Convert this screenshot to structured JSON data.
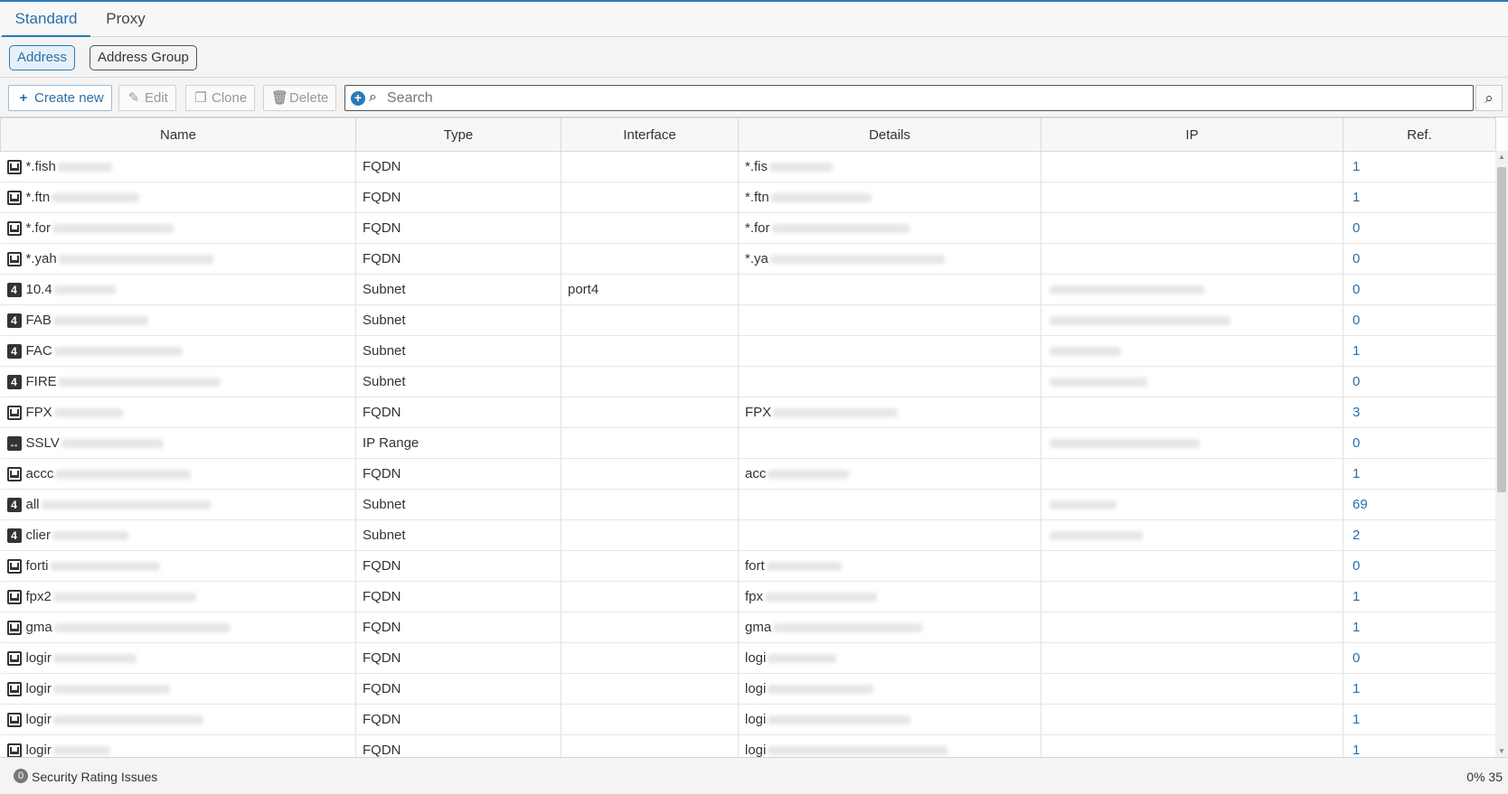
{
  "tabs": [
    {
      "label": "Standard",
      "active": true
    },
    {
      "label": "Proxy",
      "active": false
    }
  ],
  "subtabs": {
    "address": "Address",
    "address_group": "Address Group"
  },
  "toolbar": {
    "create_label": "Create new",
    "edit_label": "Edit",
    "clone_label": "Clone",
    "delete_label": "Delete",
    "search_placeholder": "Search"
  },
  "table": {
    "columns": [
      "Name",
      "Type",
      "Interface",
      "Details",
      "IP",
      "Ref."
    ],
    "rows": [
      {
        "icon": "fqdn",
        "name": "*.fish",
        "type": "FQDN",
        "interface": "",
        "details": "*.fis",
        "ip_blurred": false,
        "ref": "1"
      },
      {
        "icon": "fqdn",
        "name": "*.ftn",
        "type": "FQDN",
        "interface": "",
        "details": "*.ftn",
        "ip_blurred": false,
        "ref": "1"
      },
      {
        "icon": "fqdn",
        "name": "*.for",
        "type": "FQDN",
        "interface": "",
        "details": "*.for",
        "ip_blurred": false,
        "ref": "0"
      },
      {
        "icon": "fqdn",
        "name": "*.yah",
        "type": "FQDN",
        "interface": "",
        "details": "*.ya",
        "ip_blurred": false,
        "ref": "0"
      },
      {
        "icon": "subnet",
        "name": "10.4",
        "type": "Subnet",
        "interface": "port4",
        "details": "",
        "ip_blurred": true,
        "ref": "0"
      },
      {
        "icon": "subnet",
        "name": "FAB",
        "type": "Subnet",
        "interface": "",
        "details": "",
        "ip_blurred": true,
        "ref": "0"
      },
      {
        "icon": "subnet",
        "name": "FAC",
        "type": "Subnet",
        "interface": "",
        "details": "",
        "ip_blurred": true,
        "ref": "1"
      },
      {
        "icon": "subnet",
        "name": "FIRE",
        "type": "Subnet",
        "interface": "",
        "details": "",
        "ip_blurred": true,
        "ref": "0"
      },
      {
        "icon": "fqdn",
        "name": "FPX",
        "type": "FQDN",
        "interface": "",
        "details": "FPX",
        "ip_blurred": false,
        "ref": "3"
      },
      {
        "icon": "range",
        "name": "SSLV",
        "type": "IP Range",
        "interface": "",
        "details": "",
        "ip_blurred": true,
        "ref": "0"
      },
      {
        "icon": "fqdn",
        "name": "accc",
        "type": "FQDN",
        "interface": "",
        "details": "acc",
        "ip_blurred": false,
        "ref": "1"
      },
      {
        "icon": "subnet",
        "name": "all",
        "type": "Subnet",
        "interface": "",
        "details": "",
        "ip_blurred": true,
        "ref": "69"
      },
      {
        "icon": "subnet",
        "name": "clier",
        "type": "Subnet",
        "interface": "",
        "details": "",
        "ip_blurred": true,
        "ref": "2"
      },
      {
        "icon": "fqdn",
        "name": "forti",
        "type": "FQDN",
        "interface": "",
        "details": "fort",
        "ip_blurred": false,
        "ref": "0"
      },
      {
        "icon": "fqdn",
        "name": "fpx2",
        "type": "FQDN",
        "interface": "",
        "details": "fpx",
        "ip_blurred": false,
        "ref": "1"
      },
      {
        "icon": "fqdn",
        "name": "gma",
        "type": "FQDN",
        "interface": "",
        "details": "gma",
        "ip_blurred": false,
        "ref": "1"
      },
      {
        "icon": "fqdn",
        "name": "logir",
        "type": "FQDN",
        "interface": "",
        "details": "logi",
        "ip_blurred": false,
        "ref": "0"
      },
      {
        "icon": "fqdn",
        "name": "logir",
        "type": "FQDN",
        "interface": "",
        "details": "logi",
        "ip_blurred": false,
        "ref": "1"
      },
      {
        "icon": "fqdn",
        "name": "logir",
        "type": "FQDN",
        "interface": "",
        "details": "logi",
        "ip_blurred": false,
        "ref": "1"
      },
      {
        "icon": "fqdn",
        "name": "logir",
        "type": "FQDN",
        "interface": "",
        "details": "logi",
        "ip_blurred": false,
        "ref": "1"
      }
    ]
  },
  "footer": {
    "security_count": "0",
    "security_label": "Security Rating Issues",
    "progress_text": "0% 35"
  }
}
